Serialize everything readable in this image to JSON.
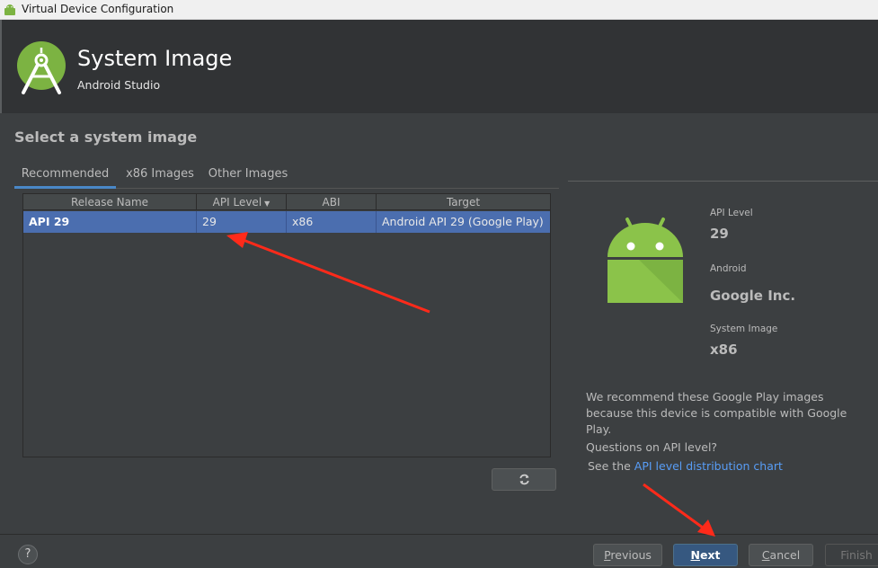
{
  "window": {
    "title": "Virtual Device Configuration"
  },
  "header": {
    "title": "System Image",
    "subtitle": "Android Studio"
  },
  "section_title": "Select a system image",
  "tabs": [
    {
      "label": "Recommended",
      "active": true
    },
    {
      "label": "x86 Images",
      "active": false
    },
    {
      "label": "Other Images",
      "active": false
    }
  ],
  "table": {
    "columns": [
      "Release Name",
      "API Level",
      "ABI",
      "Target"
    ],
    "sort_column": "API Level",
    "rows": [
      {
        "release_name": "API 29",
        "api_level": "29",
        "abi": "x86",
        "target": "Android API 29 (Google Play)",
        "selected": true
      }
    ]
  },
  "details": {
    "api_level_label": "API Level",
    "api_level_value": "29",
    "android_label": "Android",
    "android_value": "Google Inc.",
    "system_image_label": "System Image",
    "system_image_value": "x86",
    "recommend_text": "We recommend these Google Play images because this device is compatible with Google Play.",
    "questions_text": "Questions on API level?",
    "see_prefix": "See the ",
    "link_text": "API level distribution chart"
  },
  "footer": {
    "help_label": "?",
    "previous_first": "P",
    "previous_rest": "revious",
    "next_first": "N",
    "next_rest": "ext",
    "cancel_first": "C",
    "cancel_rest": "ancel",
    "finish_label": "Finish"
  },
  "colors": {
    "accent": "#4a88c7",
    "selection": "#4b6eaf",
    "android_green": "#8bc34a",
    "link": "#589df6",
    "annotation_arrow": "#ff2a1a"
  }
}
